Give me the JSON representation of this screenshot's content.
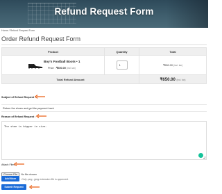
{
  "hero": {
    "title": "Refund Request Form"
  },
  "breadcrumb": {
    "home": "Home",
    "separator": "/",
    "current": "Refund Request Form"
  },
  "page": {
    "title": "Order Refund Request Form"
  },
  "table": {
    "headers": {
      "product": "Product",
      "quantity": "Quantity",
      "total": "Total"
    },
    "item": {
      "name": "Boy's Football Boots • 1",
      "price_label": "Price :",
      "price_value": "₹650.00",
      "price_suffix": "(incl. tax)",
      "quantity": "1",
      "line_total": "₹650.00",
      "line_total_suffix": "(incl. tax)"
    },
    "total_label": "Total Refund Amount",
    "total_value": "₹650.00",
    "total_suffix": "(incl. tax)"
  },
  "subject": {
    "label": "Subject of Refund Request :",
    "value": "Return the shoes and get the payment back"
  },
  "reason": {
    "label": "Reason of Refund Request :",
    "value": "The shoe is bigger in size."
  },
  "attach": {
    "label": "Attach Files",
    "choose_button": "Choose File",
    "no_file": "No file chosen",
    "add_more": "Add More",
    "hint": "Only .png, .jpeg extension file is approved.",
    "submit": "Submit Request"
  },
  "colors": {
    "accent": "#1a6bd8",
    "arrow": "#e8590c",
    "header_bg": "#efefef",
    "grammarly": "#15c39a"
  }
}
